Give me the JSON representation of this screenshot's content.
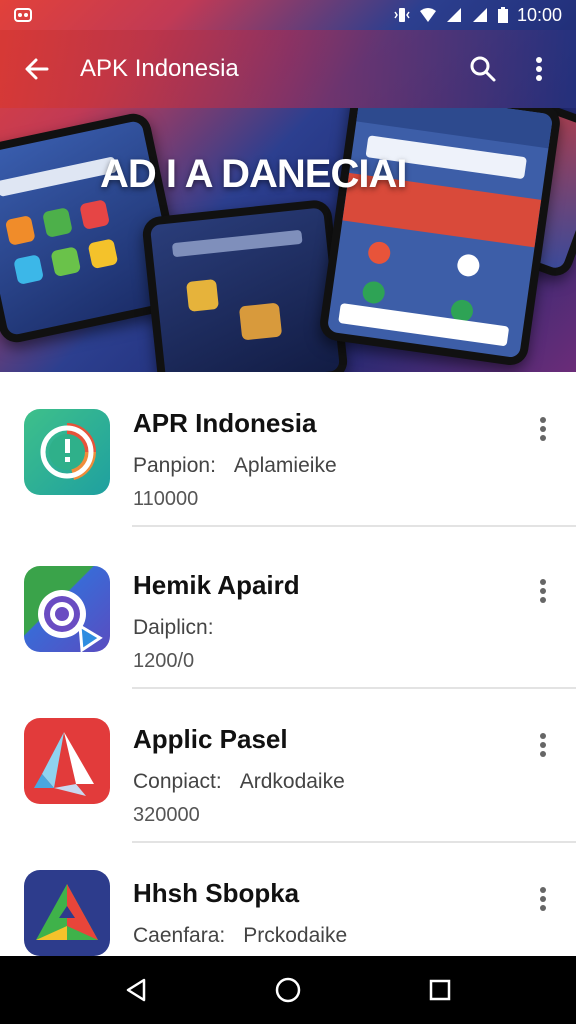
{
  "status_bar": {
    "time": "10:00",
    "left_icons": [
      "notification-icon",
      "notification-icon"
    ],
    "right_icons": [
      "vibrate-icon",
      "wifi-icon",
      "signal-icon",
      "signal-icon",
      "battery-icon"
    ]
  },
  "app_bar": {
    "title": "APK Indonesia",
    "back_icon": "arrow-left-icon",
    "search_icon": "search-icon",
    "more_icon": "more-vert-icon"
  },
  "banner": {
    "headline": "AD I A DANECIAI"
  },
  "apps": [
    {
      "title": "APR Indonesia",
      "sub_label": "Panpion:",
      "sub_value": "Aplamieike",
      "count": "110000",
      "icon": "app-icon-green-circle"
    },
    {
      "title": "Hemik Apaird",
      "sub_label": "Daiplicn:",
      "sub_value": "",
      "count": "1200/0",
      "icon": "app-icon-blue-target"
    },
    {
      "title": "Applic Pasel",
      "sub_label": "Conpiact:",
      "sub_value": "Ardkodaike",
      "count": "320000",
      "icon": "app-icon-red-triangle"
    },
    {
      "title": "Hhsh Sbopka",
      "sub_label": "Caenfara:",
      "sub_value": "Prckodaike",
      "count": "",
      "icon": "app-icon-green-delta"
    }
  ],
  "nav_bar": {
    "back": "nav-back-icon",
    "home": "nav-home-icon",
    "recents": "nav-recents-icon"
  },
  "colors": {
    "accent_red": "#e2413a",
    "accent_blue": "#2c3f8f",
    "nav_bg": "#000000"
  }
}
